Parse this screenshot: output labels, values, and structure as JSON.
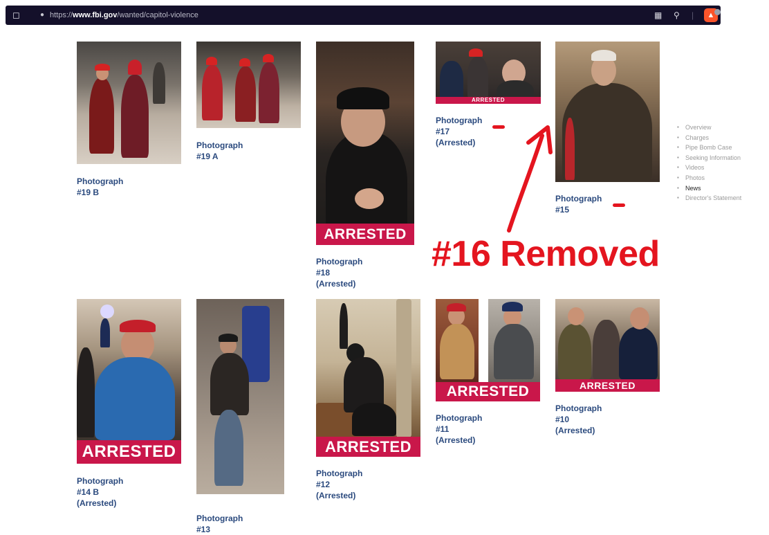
{
  "browser": {
    "url_prefix": "https://",
    "url_domain": "www.fbi.gov",
    "url_path": "/wanted/capitol-violence"
  },
  "photos": [
    {
      "caption_line1": "Photograph #19 B",
      "caption_line2": "",
      "banner": ""
    },
    {
      "caption_line1": "Photograph #19 A",
      "caption_line2": "",
      "banner": ""
    },
    {
      "caption_line1": "Photograph #18",
      "caption_line2": "(Arrested)",
      "banner": "ARRESTED"
    },
    {
      "caption_line1": "Photograph #17",
      "caption_line2": "(Arrested)",
      "banner": "ARRESTED"
    },
    {
      "caption_line1": "Photograph #15",
      "caption_line2": "",
      "banner": ""
    },
    {
      "caption_line1": "Photograph #14 B",
      "caption_line2": "(Arrested)",
      "banner": "ARRESTED"
    },
    {
      "caption_line1": "Photograph #13",
      "caption_line2": "",
      "banner": ""
    },
    {
      "caption_line1": "Photograph #12",
      "caption_line2": "(Arrested)",
      "banner": "ARRESTED"
    },
    {
      "caption_line1": "Photograph #11",
      "caption_line2": "(Arrested)",
      "banner": "ARRESTED"
    },
    {
      "caption_line1": "Photograph #10",
      "caption_line2": "(Arrested)",
      "banner": "ARRESTED"
    }
  ],
  "sidebar": {
    "items": [
      "Overview",
      "Charges",
      "Pipe Bomb Case",
      "Seeking Information",
      "Videos",
      "Photos",
      "News",
      "Director's Statement"
    ],
    "active": "News"
  },
  "annotation": {
    "text": "#16 Removed",
    "color": "#e4151f"
  },
  "colors": {
    "banner": "#c9174a",
    "caption": "#2b4a7e",
    "url_bar": "#14102a"
  }
}
